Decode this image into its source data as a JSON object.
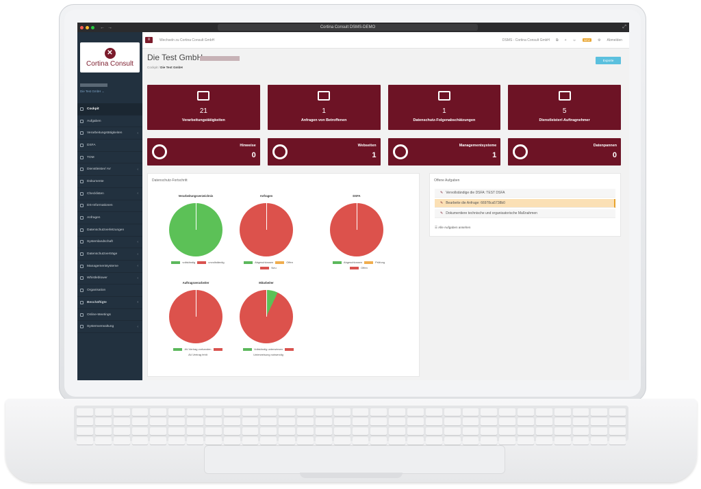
{
  "window_title": "Cortina Consult DSMS-DEMO",
  "sidebar": {
    "logo_text": "Cortina Consult",
    "company": "Die Test GmbH ⌄",
    "items": [
      {
        "label": "Cockpit",
        "active": true,
        "chev": false
      },
      {
        "label": "Aufgaben",
        "chev": false
      },
      {
        "label": "Verarbeitungstätigkeiten",
        "chev": true
      },
      {
        "label": "DSFA",
        "chev": false
      },
      {
        "label": "TOM",
        "chev": false
      },
      {
        "label": "Dienstleister/ AV",
        "chev": true
      },
      {
        "label": "Dokumente",
        "chev": false
      },
      {
        "label": "Checklisten",
        "chev": true
      },
      {
        "label": "DS-Informationen",
        "chev": false
      },
      {
        "label": "Anfragen",
        "chev": false
      },
      {
        "label": "Datenschutzverletzungen",
        "chev": false
      },
      {
        "label": "Systemlandschaft",
        "chev": true
      },
      {
        "label": "Datenschutzverträge",
        "chev": true
      },
      {
        "label": "Managementsysteme",
        "chev": true
      },
      {
        "label": "Whistleblower",
        "chev": true
      },
      {
        "label": "Organisation",
        "chev": false
      },
      {
        "label": "Beschäftigte",
        "chev": true,
        "bold": true
      },
      {
        "label": "Online-Meetings",
        "chev": false
      },
      {
        "label": "Systemverwaltung",
        "chev": true
      }
    ]
  },
  "topbar": {
    "switch_label": "Wechseln zu Cortina Consult GmbH",
    "right_label": "DSMS - Cortina Consult GmbH",
    "badge": "NEW",
    "logout": "Abmelden"
  },
  "page": {
    "title": "Die Test GmbH",
    "crumb_root": "Cockpit",
    "crumb_current": "Die Test GmbH",
    "export": "Exporte"
  },
  "tiles": [
    {
      "num": "21",
      "label": "Verarbeitungstätigkeiten",
      "icon": "list-icon"
    },
    {
      "num": "1",
      "label": "Anfragen von Betroffenen",
      "icon": "chat-icon"
    },
    {
      "num": "1",
      "label": "Datenschutz-Folgenabschätzungen",
      "icon": "chart-icon"
    },
    {
      "num": "5",
      "label": "Dienstleister/-Auftragnehmer",
      "icon": "handshake-icon"
    }
  ],
  "small_tiles": [
    {
      "num": "0",
      "label": "Hinweise",
      "icon": "whistle-icon"
    },
    {
      "num": "1",
      "label": "Webseiten",
      "icon": "monitor-icon"
    },
    {
      "num": "1",
      "label": "Managementsysteme",
      "icon": "gauge-icon"
    },
    {
      "num": "0",
      "label": "Datenpannen",
      "icon": "alert-icon"
    }
  ],
  "progress": {
    "title": "Datenschutz-Fortschritt",
    "charts": [
      {
        "title": "Verarbeitungsverzeichnis",
        "fill": "green",
        "legend": [
          {
            "c": "#5cb85c",
            "t": "vollständig"
          },
          {
            "c": "#d9534f",
            "t": "unvollständig"
          }
        ]
      },
      {
        "title": "Anfragen",
        "fill": "red",
        "legend": [
          {
            "c": "#5cb85c",
            "t": "Abgeschlossen"
          },
          {
            "c": "#f0ad4e",
            "t": "Offen"
          },
          {
            "c": "#d9534f",
            "t": "Neu"
          }
        ]
      },
      {
        "title": "DSFA",
        "fill": "red",
        "legend": [
          {
            "c": "#5cb85c",
            "t": "Abgeschlossen"
          },
          {
            "c": "#f0ad4e",
            "t": "Prüfung"
          },
          {
            "c": "#d9534f",
            "t": "Offen"
          }
        ]
      },
      {
        "title": "Auftragsverarbeiter",
        "fill": "red",
        "legend": [
          {
            "c": "#5cb85c",
            "t": "AV-Vertrag vorhanden"
          },
          {
            "c": "#d9534f",
            "t": "AV-Vertrag fehlt"
          }
        ]
      },
      {
        "title": "Mitarbeiter",
        "fill": "mix",
        "legend": [
          {
            "c": "#5cb85c",
            "t": "Vollständig unterwiesen"
          },
          {
            "c": "#d9534f",
            "t": "Unterweisung notwendig"
          }
        ]
      }
    ]
  },
  "tasks": {
    "title": "Offene Aufgaben",
    "items": [
      {
        "text": "Vervollständige die DSFA: TEST DSFA",
        "hl": false
      },
      {
        "text": "Bearbeite die Anfrage: 66978ca5738b0",
        "hl": true
      },
      {
        "text": "Dokumentiere technische und organisatorische Maßnahmen",
        "hl": false
      }
    ],
    "all": "☰ Alle Aufgaben ansehen"
  }
}
